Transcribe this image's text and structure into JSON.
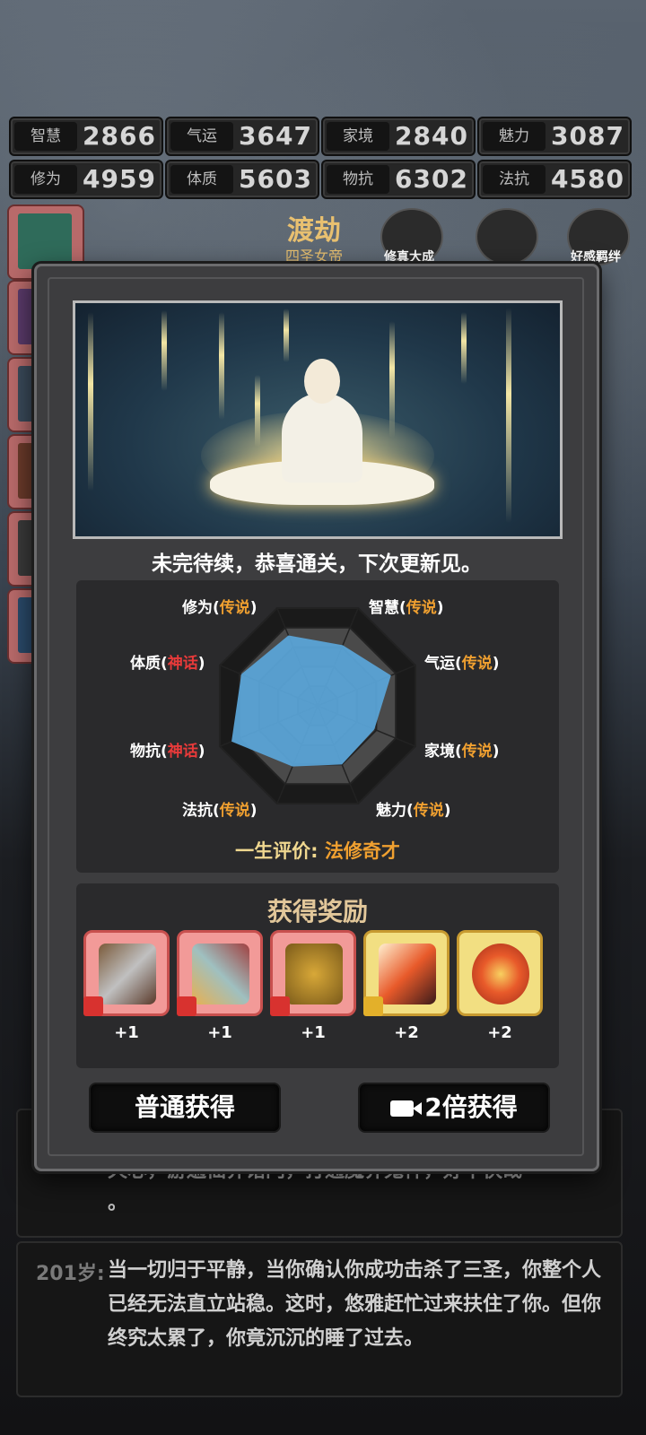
{
  "stats": [
    {
      "label": "智慧",
      "value": "2866"
    },
    {
      "label": "气运",
      "value": "3647"
    },
    {
      "label": "家境",
      "value": "2840"
    },
    {
      "label": "魅力",
      "value": "3087"
    },
    {
      "label": "修为",
      "value": "4959"
    },
    {
      "label": "体质",
      "value": "5603"
    },
    {
      "label": "物抗",
      "value": "6302"
    },
    {
      "label": "法抗",
      "value": "4580"
    }
  ],
  "header": {
    "title": "渡劫",
    "subtitle": "四圣女帝",
    "icon1_label": "修真大成",
    "icon2_label": "",
    "icon3_label": "好感羁绊"
  },
  "modal": {
    "caption": "未完待续，恭喜通关，下次更新见。",
    "radar": {
      "axes": [
        {
          "name": "修为",
          "tier": "传说",
          "tier_type": "legend",
          "value": 0.72
        },
        {
          "name": "智慧",
          "tier": "传说",
          "tier_type": "legend",
          "value": 0.62
        },
        {
          "name": "气运",
          "tier": "传说",
          "tier_type": "legend",
          "value": 0.75
        },
        {
          "name": "家境",
          "tier": "传说",
          "tier_type": "legend",
          "value": 0.58
        },
        {
          "name": "魅力",
          "tier": "传说",
          "tier_type": "legend",
          "value": 0.6
        },
        {
          "name": "法抗",
          "tier": "传说",
          "tier_type": "legend",
          "value": 0.62
        },
        {
          "name": "物抗",
          "tier": "神话",
          "tier_type": "myth",
          "value": 0.88
        },
        {
          "name": "体质",
          "tier": "神话",
          "tier_type": "myth",
          "value": 0.78
        }
      ],
      "colors": {
        "fill": "#5aa3d6",
        "legend": "#f0a030",
        "myth": "#e83a3a"
      }
    },
    "evaluation_label": "一生评价:",
    "evaluation_value": "法修奇才",
    "rewards_title": "获得奖励",
    "rewards": [
      {
        "icon": "battle-axe-icon",
        "rarity": "red",
        "count": "+1"
      },
      {
        "icon": "sword-icon",
        "rarity": "red",
        "count": "+1"
      },
      {
        "icon": "shield-token-icon",
        "rarity": "red",
        "count": "+1"
      },
      {
        "icon": "flame-feather-icon",
        "rarity": "gold",
        "count": "+2"
      },
      {
        "icon": "lotus-orb-icon",
        "rarity": "gold",
        "count": "+2"
      }
    ],
    "btn_normal": "普通获得",
    "btn_double": "2倍获得"
  },
  "log": {
    "partial_line1": "天心，游遍仙界诸门，打通魔界鬼神，好不快哉",
    "partial_line2": "。",
    "entry_age": "201岁:",
    "entry_text": "当一切归于平静，当你确认你成功击杀了三圣，你整个人已经无法直立站稳。这时，悠雅赶忙过来扶住了你。但你终究太累了，你竟沉沉的睡了过去。"
  }
}
